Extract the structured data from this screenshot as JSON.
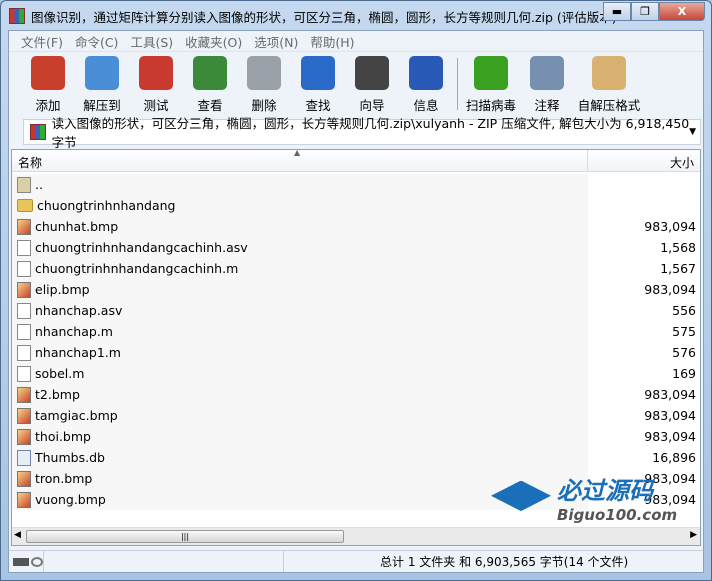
{
  "title": "图像识别，通过矩阵计算分别读入图像的形状，可区分三角，椭圆，圆形，长方等规则几何.zip (评估版本)",
  "window_buttons": [
    "▬",
    "❐",
    "X"
  ],
  "menu": [
    "文件(F)",
    "命令(C)",
    "工具(S)",
    "收藏夹(O)",
    "选项(N)",
    "帮助(H)"
  ],
  "toolbar": [
    {
      "label": "添加",
      "color": "#c8402c"
    },
    {
      "label": "解压到",
      "color": "#4a8ed8"
    },
    {
      "label": "测试",
      "color": "#c83a30"
    },
    {
      "label": "查看",
      "color": "#3a8a3a"
    },
    {
      "label": "删除",
      "color": "#9aa0a8"
    },
    {
      "label": "查找",
      "color": "#2a6ac8"
    },
    {
      "label": "向导",
      "color": "#444"
    },
    {
      "label": "信息",
      "color": "#2a5ab8"
    },
    {
      "label": "扫描病毒",
      "color": "#3aa020"
    },
    {
      "label": "注释",
      "color": "#7890b0"
    },
    {
      "label": "自解压格式",
      "color": "#d8b070"
    }
  ],
  "address": "读入图像的形状，可区分三角，椭圆，圆形，长方等规则几何.zip\\xulyanh - ZIP 压缩文件, 解包大小为 6,918,450 字节",
  "columns": {
    "name": "名称",
    "size": "大小"
  },
  "files": [
    {
      "name": "..",
      "size": "",
      "type": "up"
    },
    {
      "name": "chuongtrinhnhandang",
      "size": "",
      "type": "folder"
    },
    {
      "name": "chunhat.bmp",
      "size": "983,094",
      "type": "bmp"
    },
    {
      "name": "chuongtrinhnhandangcachinh.asv",
      "size": "1,568",
      "type": "file"
    },
    {
      "name": "chuongtrinhnhandangcachinh.m",
      "size": "1,567",
      "type": "file"
    },
    {
      "name": "elip.bmp",
      "size": "983,094",
      "type": "bmp"
    },
    {
      "name": "nhanchap.asv",
      "size": "556",
      "type": "file"
    },
    {
      "name": "nhanchap.m",
      "size": "575",
      "type": "file"
    },
    {
      "name": "nhanchap1.m",
      "size": "576",
      "type": "file"
    },
    {
      "name": "sobel.m",
      "size": "169",
      "type": "file"
    },
    {
      "name": "t2.bmp",
      "size": "983,094",
      "type": "bmp"
    },
    {
      "name": "tamgiac.bmp",
      "size": "983,094",
      "type": "bmp"
    },
    {
      "name": "thoi.bmp",
      "size": "983,094",
      "type": "bmp"
    },
    {
      "name": "Thumbs.db",
      "size": "16,896",
      "type": "db"
    },
    {
      "name": "tron.bmp",
      "size": "983,094",
      "type": "bmp"
    },
    {
      "name": "vuong.bmp",
      "size": "983,094",
      "type": "bmp"
    }
  ],
  "status": "总计 1 文件夹 和 6,903,565 字节(14 个文件)",
  "watermark": {
    "cn": "必过源码",
    "en": "Biguo100.com"
  }
}
